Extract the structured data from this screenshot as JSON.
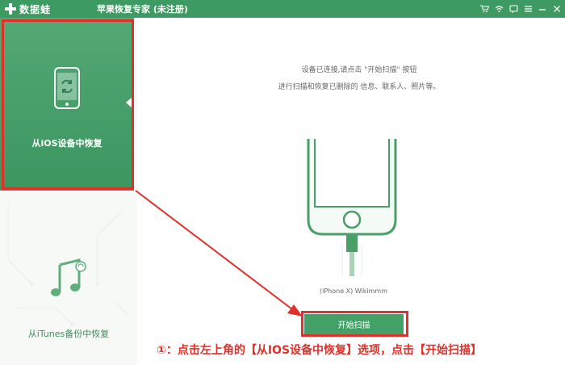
{
  "titlebar": {
    "logo_text": "数据蛙",
    "app_title": "苹果恢复专家 (未注册)",
    "controls": [
      "cart-icon",
      "wifi-icon",
      "feedback-icon",
      "menu-icon",
      "minimize-icon",
      "close-icon"
    ]
  },
  "sidebar": {
    "items": [
      {
        "label": "从iOS设备中恢复",
        "icon": "phone-refresh-icon",
        "active": true
      },
      {
        "label": "从iTunes备份中恢复",
        "icon": "music-note-icon",
        "active": false
      }
    ]
  },
  "main": {
    "hint_line1": "设备已连接,请点击 \"开始扫描\" 按钮",
    "hint_line2": "进行扫描和恢复已删除的 信息、联系人、照片等。",
    "device_name": "(iPhone X) Wikimmm",
    "scan_button_label": "开始扫描"
  },
  "annotation": {
    "text": "①：点击左上角的【从IOS设备中恢复】选项，点击【开始扫描】"
  },
  "colors": {
    "brand_green": "#3d9a62",
    "annotation_red": "#e0302a"
  }
}
